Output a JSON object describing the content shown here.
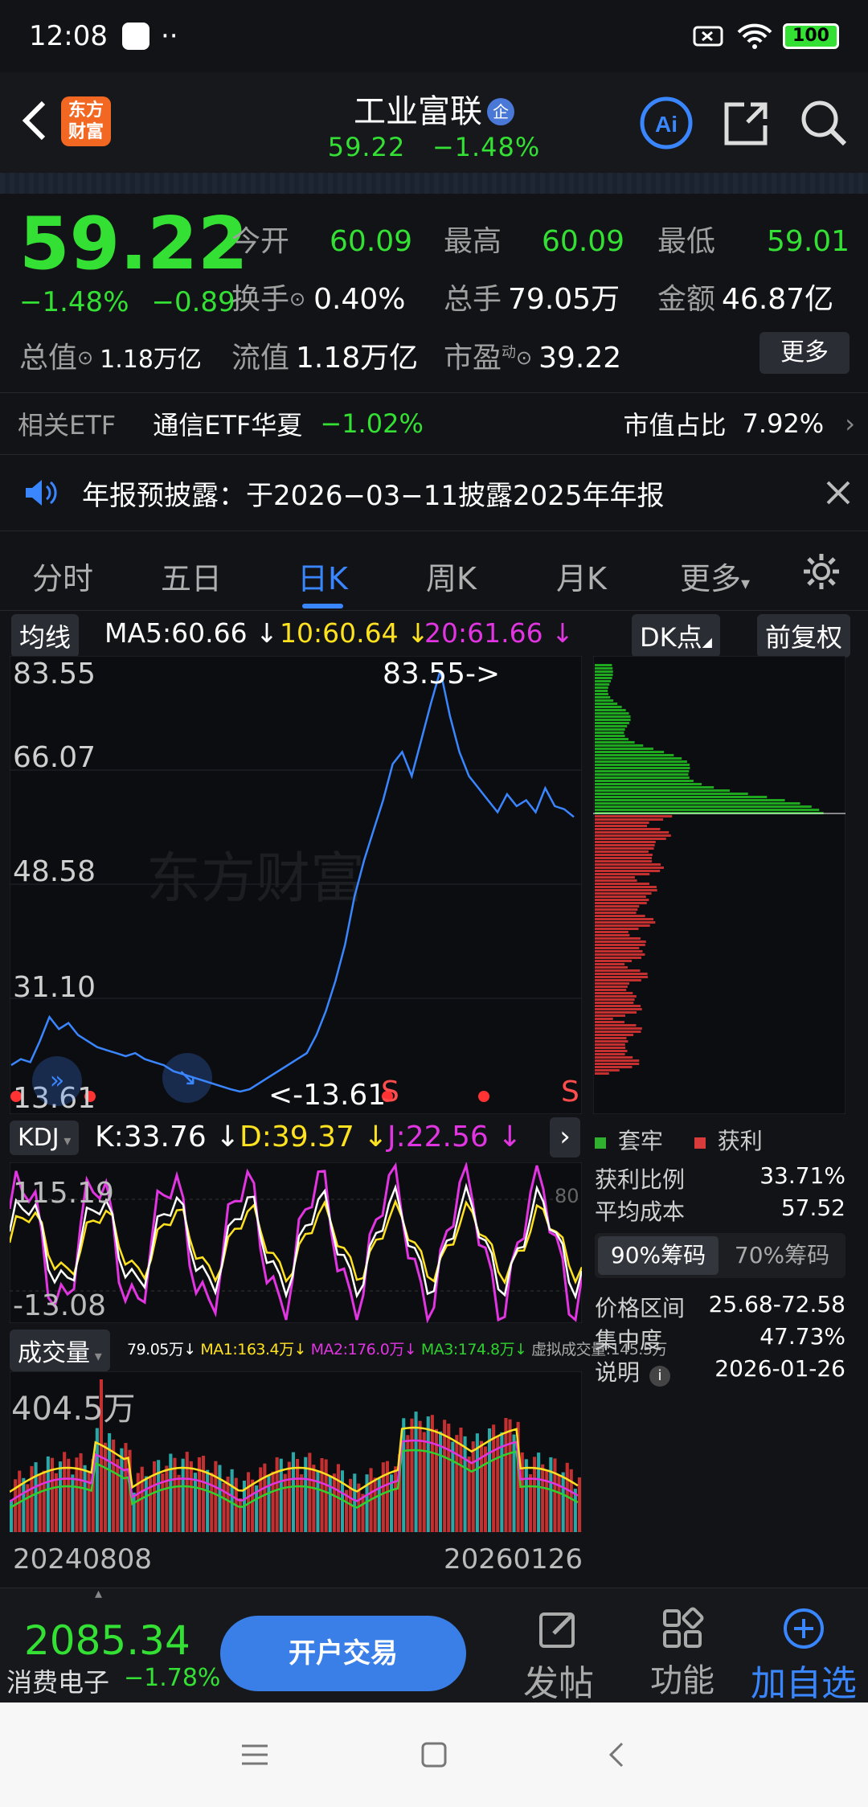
{
  "status": {
    "time": "12:08",
    "dots": "··",
    "battery": "100"
  },
  "header": {
    "title": "工业富联",
    "badge": "企",
    "price": "59.22",
    "change_pct": "−1.48%",
    "logo": "东方财富"
  },
  "quote": {
    "price": "59.22",
    "change_pct": "−1.48%",
    "change": "−0.89",
    "open_k": "今开",
    "open_v": "60.09",
    "high_k": "最高",
    "high_v": "60.09",
    "low_k": "最低",
    "low_v": "59.01",
    "turnover_k": "换手",
    "turnover_v": "0.40%",
    "vol_k": "总手",
    "vol_v": "79.05万",
    "amt_k": "金额",
    "amt_v": "46.87亿",
    "mcap_k": "总值",
    "mcap_v": "1.18万亿",
    "float_k": "流值",
    "float_v": "1.18万亿",
    "pe_k": "市盈",
    "pe_sup": "动",
    "pe_v": "39.22",
    "more": "更多"
  },
  "etf": {
    "label": "相关ETF",
    "name": "通信ETF华夏",
    "change": "−1.02%",
    "share_k": "市值占比",
    "share_v": "7.92%"
  },
  "notice": {
    "text": "年报预披露：于2026−03−11披露2025年年报"
  },
  "tabs": [
    "分时",
    "五日",
    "日K",
    "周K",
    "月K",
    "更多"
  ],
  "active_tab": "日K",
  "ma": {
    "btn": "均线",
    "ma5": "MA5:60.66 ↓",
    "ma10": "10:60.64 ↓",
    "ma20": "20:61.66 ↓",
    "dk": "DK点",
    "fq": "前复权"
  },
  "price_chart": {
    "y_labels": [
      "83.55",
      "66.07",
      "48.58",
      "31.10",
      "13.61"
    ],
    "max_label": "83.55->",
    "min_label": "<-13.61",
    "watermark": "东方财富",
    "signal": "S"
  },
  "kdj": {
    "btn": "KDJ",
    "k": "K:33.76 ↓",
    "d": "D:39.37 ↓",
    "j": "J:22.56 ↓",
    "top": "115.19",
    "bottom": "-13.08",
    "ref80": "80"
  },
  "volume": {
    "btn": "成交量",
    "v": "79.05万↓",
    "ma1": "MA1:163.4万↓",
    "ma2": "MA2:176.0万↓",
    "ma3": "MA3:174.8万↓",
    "virtual": "虚拟成交量:145.5万",
    "top": "404.5万"
  },
  "dates": {
    "start": "20240808",
    "end": "20260126"
  },
  "chip": {
    "legend_trap": "套牢",
    "legend_profit": "获利",
    "rows": [
      [
        "获利比例",
        "33.71%"
      ],
      [
        "平均成本",
        "57.52"
      ]
    ],
    "tab1": "90%筹码",
    "tab2": "70%筹码",
    "rows2": [
      [
        "价格区间",
        "25.68-72.58"
      ],
      [
        "集中度",
        "47.73%"
      ],
      [
        "说明",
        "2026-01-26"
      ]
    ]
  },
  "bottom": {
    "index_value": "2085.34",
    "index_name": "消费电子",
    "index_change": "−1.78%",
    "trade_btn": "开户交易",
    "post": "发帖",
    "func": "功能",
    "watch": "加自选"
  },
  "chart_data": {
    "type": "line",
    "title": "",
    "xlabel": "",
    "ylabel": "",
    "x_range": [
      "20240808",
      "20260126"
    ],
    "ylim": [
      13.61,
      83.55
    ],
    "max": 83.55,
    "min": 13.61,
    "last": 59.22,
    "series": [
      {
        "name": "",
        "values": [
          18,
          19,
          18.5,
          22,
          26,
          24,
          25,
          23,
          22,
          21,
          20.5,
          20,
          19.5,
          20,
          19,
          18.5,
          18,
          17,
          16.5,
          16,
          15.5,
          15,
          14.5,
          14,
          13.61,
          14,
          15,
          16,
          17,
          18,
          19,
          20,
          23,
          27,
          32,
          38,
          46,
          52,
          57,
          62,
          68,
          70,
          66,
          72,
          78,
          83.55,
          76,
          70,
          66,
          64,
          62,
          60,
          63,
          61,
          62,
          60,
          64,
          61,
          60.5,
          59.22
        ]
      }
    ]
  }
}
